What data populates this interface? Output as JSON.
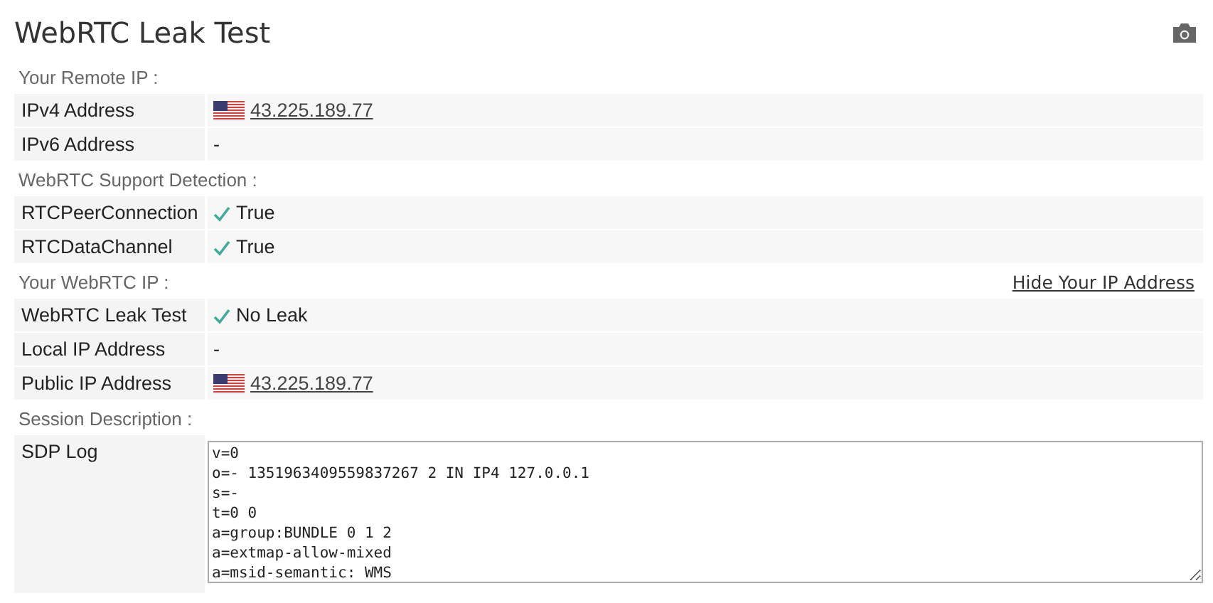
{
  "title": "WebRTC Leak Test",
  "sections": [
    {
      "heading": "Your Remote IP :",
      "rows": [
        {
          "label": "IPv4 Address",
          "kind": "ip",
          "value": "43.225.189.77"
        },
        {
          "label": "IPv6 Address",
          "kind": "text",
          "value": "-"
        }
      ]
    },
    {
      "heading": "WebRTC Support Detection :",
      "rows": [
        {
          "label": "RTCPeerConnection",
          "kind": "check",
          "value": "True"
        },
        {
          "label": "RTCDataChannel",
          "kind": "check",
          "value": "True"
        }
      ]
    },
    {
      "heading": "Your WebRTC IP :",
      "link": "Hide Your IP Address",
      "rows": [
        {
          "label": "WebRTC Leak Test",
          "kind": "check",
          "value": "No Leak"
        },
        {
          "label": "Local IP Address",
          "kind": "text",
          "value": "-"
        },
        {
          "label": "Public IP Address",
          "kind": "ip",
          "value": "43.225.189.77"
        }
      ]
    },
    {
      "heading": "Session Description :",
      "rows": [
        {
          "label": "SDP Log",
          "kind": "log",
          "lines": [
            "v=0",
            "o=- 1351963409559837267 2 IN IP4 127.0.0.1",
            "s=-",
            "t=0 0",
            "a=group:BUNDLE 0 1 2",
            "a=extmap-allow-mixed",
            "a=msid-semantic: WMS"
          ]
        }
      ]
    }
  ]
}
